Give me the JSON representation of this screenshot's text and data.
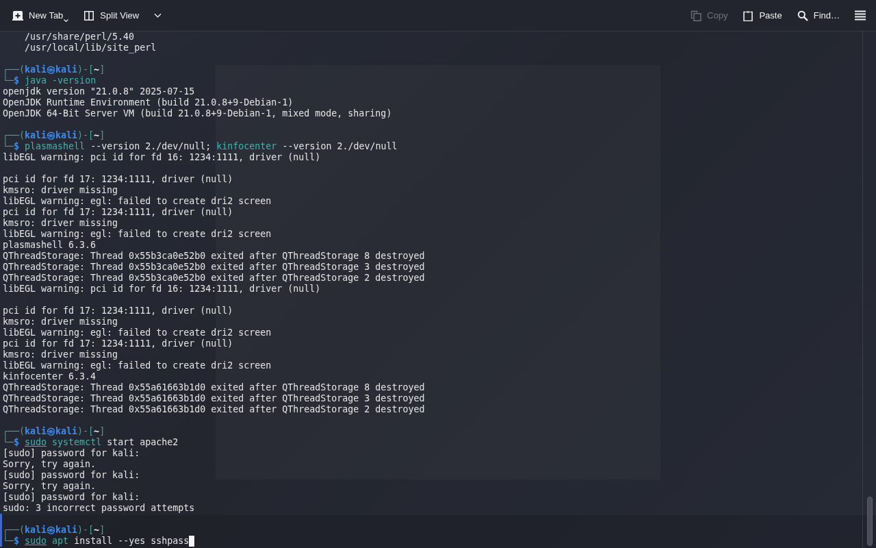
{
  "toolbar": {
    "left": [
      {
        "kind": "new-tab",
        "label": "New Tab",
        "disabled": false,
        "menu_indicator": true
      },
      {
        "kind": "split-view",
        "label": "Split View",
        "disabled": false,
        "menu_indicator": false
      },
      {
        "kind": "dropdown",
        "disabled": false,
        "menu_indicator": false
      }
    ],
    "right": [
      {
        "kind": "copy",
        "label": "Copy",
        "disabled": true,
        "menu_indicator": false
      },
      {
        "kind": "paste",
        "label": "Paste",
        "disabled": false,
        "menu_indicator": false
      },
      {
        "kind": "find",
        "label": "Find…",
        "disabled": false,
        "menu_indicator": false
      },
      {
        "kind": "menu",
        "disabled": false,
        "menu_indicator": false
      }
    ]
  },
  "terminal": {
    "leading_output": [
      "    /usr/share/perl/5.40",
      "    /usr/local/lib/site_perl"
    ],
    "sessions": [
      {
        "marked": false,
        "cursor": false,
        "prompt": {
          "open": "┌──(",
          "user": "kali㉿kali",
          "mid": ")-[",
          "path": "~",
          "close": "]",
          "corner": "└─",
          "symbol": "$"
        },
        "command": [
          {
            "text": "java",
            "kind": "command"
          },
          {
            "text": "-version",
            "kind": "command"
          }
        ],
        "output": [
          [
            "openjdk version \"21.0.8\" 2025-07-15",
            "OpenJDK Runtime Environment (build 21.0.8+9-Debian-1)",
            "OpenJDK 64-Bit Server VM (build 21.0.8+9-Debian-1, mixed mode, sharing)"
          ]
        ]
      },
      {
        "marked": false,
        "cursor": false,
        "prompt": {
          "open": "┌──(",
          "user": "kali㉿kali",
          "mid": ")-[",
          "path": "~",
          "close": "]",
          "corner": "└─",
          "symbol": "$"
        },
        "command": [
          {
            "text": "plasmashell",
            "kind": "command"
          },
          {
            "text": "--version",
            "kind": "argument"
          },
          {
            "text": "2./dev/null;",
            "kind": "argument"
          },
          {
            "text": "kinfocenter",
            "kind": "command"
          },
          {
            "text": "--version",
            "kind": "argument"
          },
          {
            "text": "2./dev/null",
            "kind": "argument"
          }
        ],
        "output": [
          [
            "libEGL warning: pci id for fd 16: 1234:1111, driver (null)"
          ],
          [
            "pci id for fd 17: 1234:1111, driver (null)",
            "kmsro: driver missing",
            "libEGL warning: egl: failed to create dri2 screen",
            "pci id for fd 17: 1234:1111, driver (null)",
            "kmsro: driver missing",
            "libEGL warning: egl: failed to create dri2 screen",
            "plasmashell 6.3.6",
            "QThreadStorage: Thread 0x55b3ca0e52b0 exited after QThreadStorage 8 destroyed",
            "QThreadStorage: Thread 0x55b3ca0e52b0 exited after QThreadStorage 3 destroyed",
            "QThreadStorage: Thread 0x55b3ca0e52b0 exited after QThreadStorage 2 destroyed",
            "libEGL warning: pci id for fd 16: 1234:1111, driver (null)"
          ],
          [
            "pci id for fd 17: 1234:1111, driver (null)",
            "kmsro: driver missing",
            "libEGL warning: egl: failed to create dri2 screen",
            "pci id for fd 17: 1234:1111, driver (null)",
            "kmsro: driver missing",
            "libEGL warning: egl: failed to create dri2 screen",
            "kinfocenter 6.3.4",
            "QThreadStorage: Thread 0x55a61663b1d0 exited after QThreadStorage 8 destroyed",
            "QThreadStorage: Thread 0x55a61663b1d0 exited after QThreadStorage 3 destroyed",
            "QThreadStorage: Thread 0x55a61663b1d0 exited after QThreadStorage 2 destroyed"
          ]
        ]
      },
      {
        "marked": false,
        "cursor": false,
        "prompt": {
          "open": "┌──(",
          "user": "kali㉿kali",
          "mid": ")-[",
          "path": "~",
          "close": "]",
          "corner": "└─",
          "symbol": "$"
        },
        "command": [
          {
            "text": "sudo",
            "kind": "precommand"
          },
          {
            "text": "systemctl",
            "kind": "command"
          },
          {
            "text": "start",
            "kind": "argument"
          },
          {
            "text": "apache2",
            "kind": "argument"
          }
        ],
        "output": [
          [
            "[sudo] password for kali:",
            "Sorry, try again.",
            "[sudo] password for kali:",
            "Sorry, try again.",
            "[sudo] password for kali:",
            "sudo: 3 incorrect password attempts"
          ]
        ]
      },
      {
        "marked": true,
        "cursor": true,
        "prompt": {
          "open": "┌──(",
          "user": "kali㉿kali",
          "mid": ")-[",
          "path": "~",
          "close": "]",
          "corner": "└─",
          "symbol": "$"
        },
        "command": [
          {
            "text": "sudo",
            "kind": "precommand"
          },
          {
            "text": "apt",
            "kind": "command"
          },
          {
            "text": "install",
            "kind": "argument"
          },
          {
            "text": "--yes",
            "kind": "argument"
          },
          {
            "text": "sshpass",
            "kind": "argument"
          }
        ]
      }
    ]
  }
}
